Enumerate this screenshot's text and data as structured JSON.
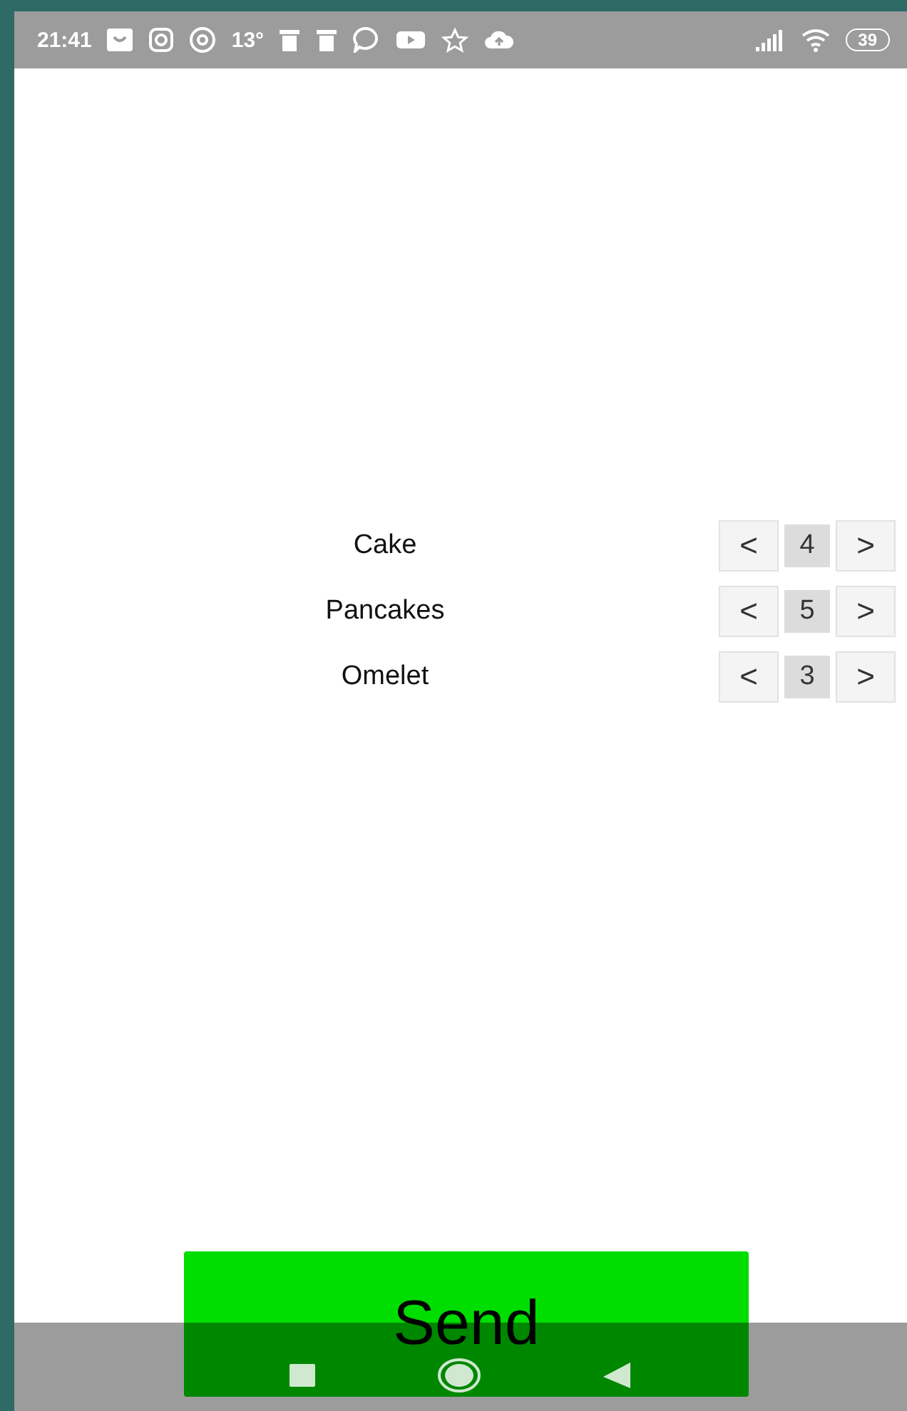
{
  "status_bar": {
    "time": "21:41",
    "temperature": "13°",
    "battery": "39"
  },
  "items": [
    {
      "name": "Cake",
      "decrement": "<",
      "count": "4",
      "increment": ">"
    },
    {
      "name": "Pancakes",
      "decrement": "<",
      "count": "5",
      "increment": ">"
    },
    {
      "name": "Omelet",
      "decrement": "<",
      "count": "3",
      "increment": ">"
    }
  ],
  "send_button": {
    "label": "Send"
  }
}
